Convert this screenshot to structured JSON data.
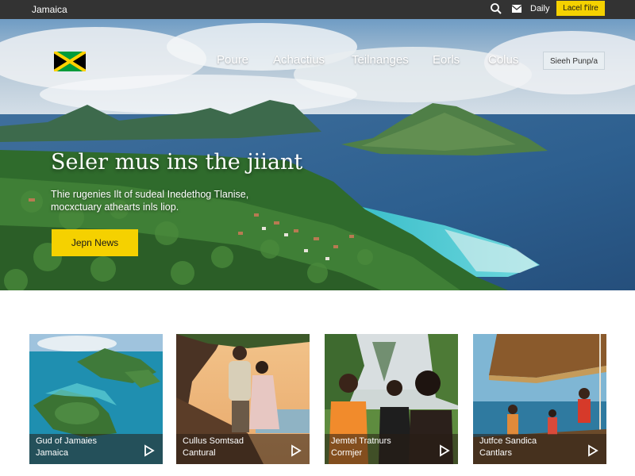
{
  "topbar": {
    "brand": "Jamaica",
    "search_icon": "search-icon",
    "mail_icon": "mail-icon",
    "daily_label": "Daily",
    "button_label": "Lacel f'ilre"
  },
  "hero": {
    "nav": [
      "Poure",
      "Achactius",
      "Teilnanges",
      "Eorls",
      "Colus"
    ],
    "nav_button": "Sieeh Punp/a",
    "headline": "Seler mus ins the jiiant",
    "subtext_line1": "Thie rugenies Ilt of sudeal Inedethog Tlanise,",
    "subtext_line2": "mocxctuary athearts inls liop.",
    "cta_label": "Jepn News",
    "colors": {
      "accent": "#f5d100",
      "topbar": "#333333"
    }
  },
  "cards": [
    {
      "line1": "Gud of Jamaies",
      "line2": "Jamaica"
    },
    {
      "line1": "Cullus Somtsad",
      "line2": "Cantural"
    },
    {
      "line1": "Jemtel Tratnurs",
      "line2": "Cormjer"
    },
    {
      "line1": "Jutfce Sandica",
      "line2": "Cantlars"
    }
  ]
}
